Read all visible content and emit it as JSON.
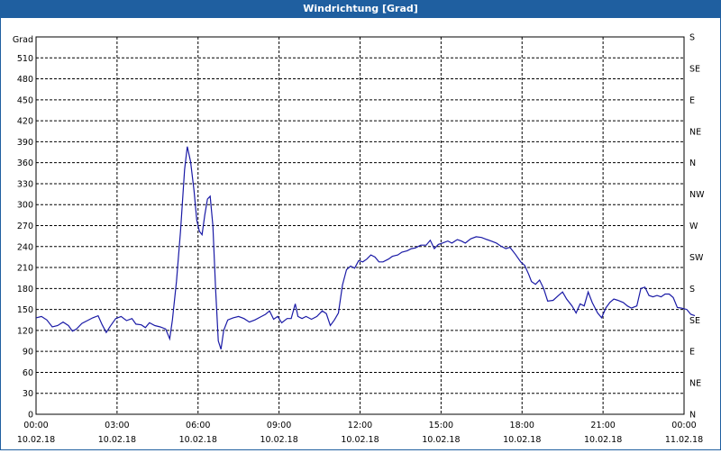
{
  "window": {
    "title": "Windrichtung [Grad]"
  },
  "colors": {
    "title_bg": "#1f5fa0",
    "line": "#1a1aa6",
    "grid": "#000000"
  },
  "chart_data": {
    "type": "line",
    "title": "Windrichtung [Grad]",
    "ylabel": "Grad",
    "ylim": [
      0,
      540
    ],
    "yticks": [
      0,
      30,
      60,
      90,
      120,
      150,
      180,
      210,
      240,
      270,
      300,
      330,
      360,
      390,
      420,
      450,
      480,
      510
    ],
    "right_axis_labels": [
      "N",
      "NE",
      "E",
      "SE",
      "S",
      "SW",
      "W",
      "NW",
      "N",
      "NE",
      "E",
      "SE",
      "S"
    ],
    "right_axis_values": [
      0,
      45,
      90,
      135,
      180,
      225,
      270,
      315,
      360,
      405,
      450,
      495,
      540
    ],
    "xlim_hours": [
      0,
      24
    ],
    "x_ticks": [
      {
        "time": "00:00",
        "date": "10.02.18"
      },
      {
        "time": "03:00",
        "date": "10.02.18"
      },
      {
        "time": "06:00",
        "date": "10.02.18"
      },
      {
        "time": "09:00",
        "date": "10.02.18"
      },
      {
        "time": "12:00",
        "date": "10.02.18"
      },
      {
        "time": "15:00",
        "date": "10.02.18"
      },
      {
        "time": "18:00",
        "date": "10.02.18"
      },
      {
        "time": "21:00",
        "date": "10.02.18"
      },
      {
        "time": "00:00",
        "date": "11.02.18"
      }
    ],
    "grid": true,
    "series": [
      {
        "points": [
          [
            0.0,
            138
          ],
          [
            0.2,
            140
          ],
          [
            0.4,
            135
          ],
          [
            0.6,
            125
          ],
          [
            0.8,
            127
          ],
          [
            1.0,
            132
          ],
          [
            1.2,
            127
          ],
          [
            1.35,
            119
          ],
          [
            1.5,
            122
          ],
          [
            1.7,
            130
          ],
          [
            1.9,
            134
          ],
          [
            2.1,
            138
          ],
          [
            2.3,
            141
          ],
          [
            2.45,
            128
          ],
          [
            2.6,
            117
          ],
          [
            2.75,
            126
          ],
          [
            2.95,
            137
          ],
          [
            3.15,
            140
          ],
          [
            3.35,
            134
          ],
          [
            3.55,
            137
          ],
          [
            3.7,
            129
          ],
          [
            3.9,
            128
          ],
          [
            4.05,
            124
          ],
          [
            4.2,
            131
          ],
          [
            4.4,
            127
          ],
          [
            4.6,
            125
          ],
          [
            4.8,
            122
          ],
          [
            4.95,
            108
          ],
          [
            5.05,
            135
          ],
          [
            5.2,
            190
          ],
          [
            5.35,
            262
          ],
          [
            5.5,
            350
          ],
          [
            5.6,
            383
          ],
          [
            5.72,
            362
          ],
          [
            5.85,
            320
          ],
          [
            5.95,
            278
          ],
          [
            6.05,
            262
          ],
          [
            6.15,
            257
          ],
          [
            6.25,
            285
          ],
          [
            6.35,
            308
          ],
          [
            6.45,
            312
          ],
          [
            6.55,
            270
          ],
          [
            6.65,
            180
          ],
          [
            6.75,
            105
          ],
          [
            6.85,
            93
          ],
          [
            6.95,
            120
          ],
          [
            7.1,
            135
          ],
          [
            7.3,
            138
          ],
          [
            7.5,
            140
          ],
          [
            7.7,
            137
          ],
          [
            7.9,
            132
          ],
          [
            8.1,
            135
          ],
          [
            8.3,
            139
          ],
          [
            8.5,
            143
          ],
          [
            8.65,
            148
          ],
          [
            8.8,
            136
          ],
          [
            8.95,
            140
          ],
          [
            9.1,
            131
          ],
          [
            9.3,
            137
          ],
          [
            9.45,
            137
          ],
          [
            9.6,
            158
          ],
          [
            9.7,
            140
          ],
          [
            9.85,
            137
          ],
          [
            10.0,
            140
          ],
          [
            10.2,
            136
          ],
          [
            10.4,
            140
          ],
          [
            10.6,
            148
          ],
          [
            10.75,
            144
          ],
          [
            10.9,
            127
          ],
          [
            11.05,
            135
          ],
          [
            11.2,
            145
          ],
          [
            11.35,
            185
          ],
          [
            11.5,
            207
          ],
          [
            11.65,
            212
          ],
          [
            11.8,
            209
          ],
          [
            11.95,
            220
          ],
          [
            12.1,
            218
          ],
          [
            12.25,
            222
          ],
          [
            12.4,
            228
          ],
          [
            12.55,
            225
          ],
          [
            12.7,
            218
          ],
          [
            12.85,
            218
          ],
          [
            13.05,
            222
          ],
          [
            13.2,
            226
          ],
          [
            13.4,
            228
          ],
          [
            13.55,
            232
          ],
          [
            13.75,
            234
          ],
          [
            13.9,
            237
          ],
          [
            14.05,
            238
          ],
          [
            14.25,
            242
          ],
          [
            14.45,
            242
          ],
          [
            14.6,
            249
          ],
          [
            14.75,
            237
          ],
          [
            14.9,
            243
          ],
          [
            15.05,
            245
          ],
          [
            15.25,
            248
          ],
          [
            15.4,
            245
          ],
          [
            15.6,
            250
          ],
          [
            15.75,
            248
          ],
          [
            15.9,
            245
          ],
          [
            16.1,
            251
          ],
          [
            16.3,
            254
          ],
          [
            16.5,
            253
          ],
          [
            16.7,
            250
          ],
          [
            16.85,
            248
          ],
          [
            17.05,
            245
          ],
          [
            17.2,
            241
          ],
          [
            17.4,
            237
          ],
          [
            17.55,
            239
          ],
          [
            17.75,
            229
          ],
          [
            17.95,
            218
          ],
          [
            18.1,
            213
          ],
          [
            18.25,
            200
          ],
          [
            18.35,
            190
          ],
          [
            18.5,
            186
          ],
          [
            18.65,
            192
          ],
          [
            18.8,
            180
          ],
          [
            18.95,
            162
          ],
          [
            19.15,
            163
          ],
          [
            19.35,
            170
          ],
          [
            19.5,
            175
          ],
          [
            19.65,
            165
          ],
          [
            19.85,
            155
          ],
          [
            20.0,
            145
          ],
          [
            20.15,
            158
          ],
          [
            20.3,
            155
          ],
          [
            20.45,
            175
          ],
          [
            20.6,
            160
          ],
          [
            20.8,
            145
          ],
          [
            20.95,
            138
          ],
          [
            21.1,
            152
          ],
          [
            21.25,
            160
          ],
          [
            21.4,
            165
          ],
          [
            21.55,
            163
          ],
          [
            21.75,
            160
          ],
          [
            21.9,
            155
          ],
          [
            22.05,
            152
          ],
          [
            22.25,
            155
          ],
          [
            22.4,
            180
          ],
          [
            22.55,
            182
          ],
          [
            22.7,
            170
          ],
          [
            22.85,
            168
          ],
          [
            23.0,
            170
          ],
          [
            23.15,
            168
          ],
          [
            23.3,
            172
          ],
          [
            23.45,
            172
          ],
          [
            23.6,
            167
          ],
          [
            23.75,
            153
          ],
          [
            23.9,
            152
          ],
          [
            24.1,
            150
          ],
          [
            24.25,
            143
          ],
          [
            24.4,
            141
          ]
        ]
      }
    ]
  }
}
